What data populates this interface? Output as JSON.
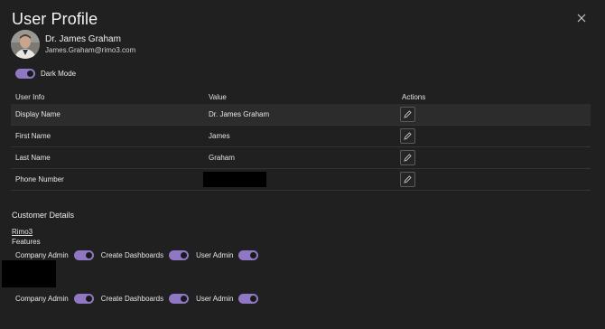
{
  "dialog": {
    "title": "User Profile",
    "close_icon": "close-icon"
  },
  "profile": {
    "name": "Dr. James Graham",
    "email": "James.Graham@rimo3.com",
    "avatar_icon": "avatar"
  },
  "dark_mode": {
    "label": "Dark Mode",
    "enabled": true
  },
  "table": {
    "headers": [
      "User Info",
      "Value",
      "Actions"
    ],
    "rows": [
      {
        "field": "Display Name",
        "value": "Dr. James Graham",
        "selected": true
      },
      {
        "field": "First Name",
        "value": "James"
      },
      {
        "field": "Last Name",
        "value": "Graham"
      },
      {
        "field": "Phone Number",
        "value": "",
        "redacted": true
      }
    ],
    "action_icon": "pencil-icon"
  },
  "customer": {
    "title": "Customer Details",
    "org": "Rimo3",
    "features_label": "Features",
    "feature_rows": [
      {
        "items": [
          {
            "label": "Company Admin",
            "on": true
          },
          {
            "label": "Create Dashboards",
            "on": true
          },
          {
            "label": "User Admin",
            "on": true
          }
        ]
      },
      {
        "items": [
          {
            "label": "Company Admin",
            "on": true
          },
          {
            "label": "Create Dashboards",
            "on": true
          },
          {
            "label": "User Admin",
            "on": true
          }
        ]
      }
    ]
  },
  "colors": {
    "accent": "#8f77c4",
    "background": "#202020",
    "selected_row": "#2c2c2c"
  }
}
